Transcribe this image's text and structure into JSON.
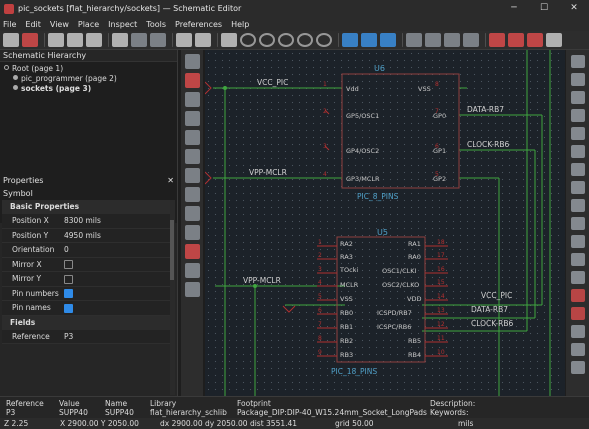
{
  "window": {
    "title": "pic_sockets [flat_hierarchy/sockets] — Schematic Editor",
    "minimize": "─",
    "maximize": "☐",
    "close": "✕"
  },
  "menu": [
    "File",
    "Edit",
    "View",
    "Place",
    "Inspect",
    "Tools",
    "Preferences",
    "Help"
  ],
  "hierarchy": {
    "title": "Schematic Hierarchy",
    "close": "✕",
    "items": [
      {
        "label": "Root (page 1)"
      },
      {
        "label": "pic_programmer (page 2)"
      },
      {
        "label": "sockets (page 3)"
      }
    ]
  },
  "properties": {
    "title": "Properties",
    "close": "✕",
    "kind": "Symbol",
    "section_basic": "Basic Properties",
    "rows": [
      {
        "k": "Position X",
        "v": "8300 mils"
      },
      {
        "k": "Position Y",
        "v": "4950 mils"
      },
      {
        "k": "Orientation",
        "v": "0"
      },
      {
        "k": "Mirror X",
        "v": ""
      },
      {
        "k": "Mirror Y",
        "v": ""
      },
      {
        "k": "Pin numbers",
        "v": ""
      },
      {
        "k": "Pin names",
        "v": ""
      }
    ],
    "checks": {
      "mirror_x": false,
      "mirror_y": false,
      "pin_numbers": true,
      "pin_names": true
    },
    "section_fields": "Fields",
    "field_rows": [
      {
        "k": "Reference",
        "v": "P3"
      }
    ]
  },
  "info": {
    "reference_label": "Reference",
    "reference": "P3",
    "value_label": "Value",
    "value": "SUPP40",
    "name_label": "Name",
    "name": "SUPP40",
    "library_label": "Library",
    "library": "flat_hierarchy_schlib",
    "footprint_label": "Footprint",
    "footprint": "Package_DIP:DIP-40_W15.24mm_Socket_LongPads",
    "description_label": "Description:",
    "keywords_label": "Keywords:"
  },
  "status": {
    "zoom": "Z 2.25",
    "xy": "X 2900.00  Y 2050.00",
    "dxy": "dx 2900.00  dy 2050.00  dist 3551.41",
    "grid": "grid 50.00",
    "units": "mils"
  },
  "u6": {
    "ref": "U6",
    "value": "PIC_8_PINS",
    "left_pins": [
      {
        "num": "1",
        "name": "Vdd"
      },
      {
        "num": "2",
        "name": "GP5/OSC1"
      },
      {
        "num": "3",
        "name": "GP4/OSC2"
      },
      {
        "num": "4",
        "name": "GP3/MCLR"
      }
    ],
    "right_pins": [
      {
        "num": "8",
        "name": "VSS"
      },
      {
        "num": "7",
        "name": "GP0"
      },
      {
        "num": "6",
        "name": "GP1"
      },
      {
        "num": "5",
        "name": "GP2"
      }
    ]
  },
  "u5": {
    "ref": "U5",
    "value": "PIC_18_PINS",
    "left_pins": [
      {
        "num": "1",
        "name": "RA2"
      },
      {
        "num": "2",
        "name": "RA3"
      },
      {
        "num": "3",
        "name": "TOcki"
      },
      {
        "num": "4",
        "name": "MCLR"
      },
      {
        "num": "5",
        "name": "VSS"
      },
      {
        "num": "6",
        "name": "RB0"
      },
      {
        "num": "7",
        "name": "RB1"
      },
      {
        "num": "8",
        "name": "RB2"
      },
      {
        "num": "9",
        "name": "RB3"
      }
    ],
    "right_pins": [
      {
        "num": "18",
        "name": "RA1"
      },
      {
        "num": "17",
        "name": "RA0"
      },
      {
        "num": "16",
        "name": "OSC1/CLKI"
      },
      {
        "num": "15",
        "name": "OSC2/CLKO"
      },
      {
        "num": "14",
        "name": "VDD"
      },
      {
        "num": "13",
        "name": "ICSPD/RB7"
      },
      {
        "num": "12",
        "name": "ICSPC/RB6"
      },
      {
        "num": "11",
        "name": "RB5"
      },
      {
        "num": "10",
        "name": "RB4"
      }
    ]
  },
  "nets": {
    "vcc_pic": "VCC_PIC",
    "vpp_mclr": "VPP-MCLR",
    "data_rb7": "DATA-RB7",
    "clock_rb6": "CLOCK-RB6"
  },
  "colors": {
    "canvas": "#1c2229",
    "wire": "#3fa63f",
    "body": "#8f4040",
    "pin": "#b03030",
    "label": "#c8c8c8",
    "net": "#d0d0d0",
    "ref": "#50a0c8"
  }
}
